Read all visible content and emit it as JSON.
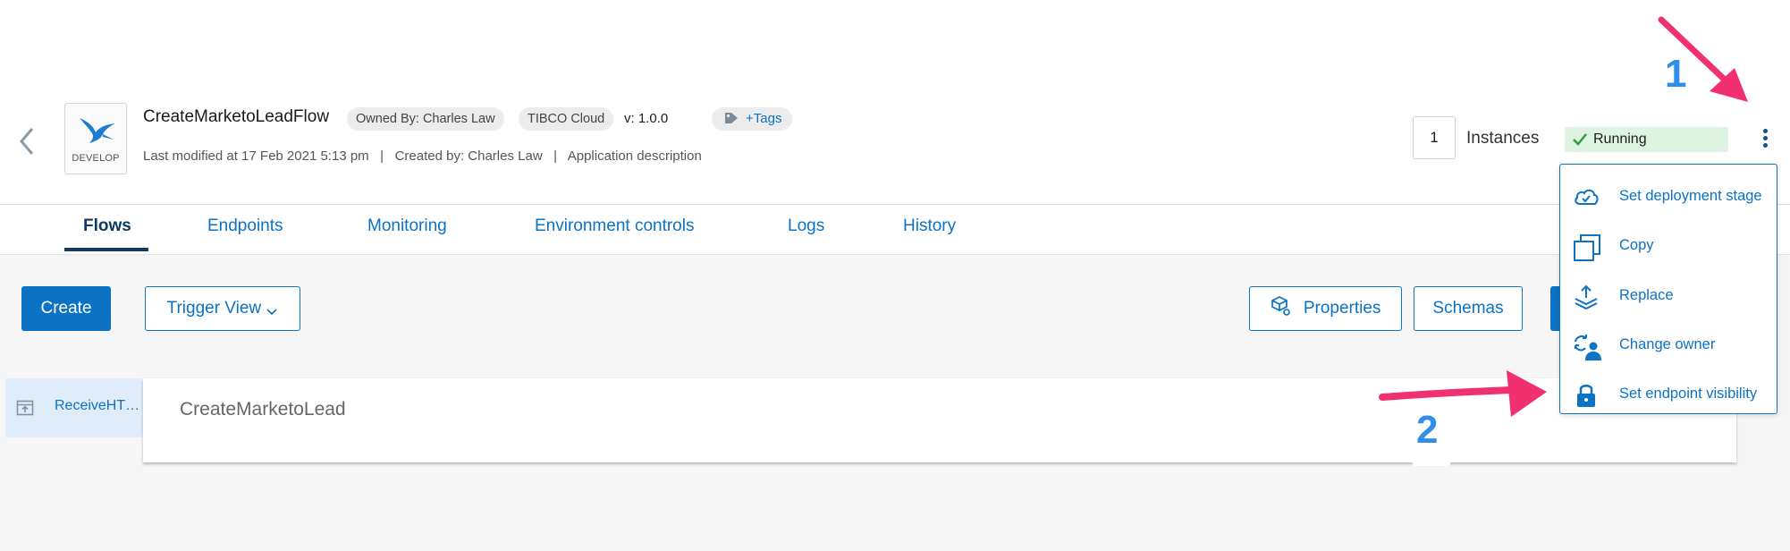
{
  "header": {
    "logo_label": "DEVELOP",
    "app_title": "CreateMarketoLeadFlow",
    "owner_label": "Owned By: Charles Law",
    "platform_label": "TIBCO Cloud",
    "version": "v: 1.0.0",
    "tags_label": "+Tags",
    "meta_line": "Last modified at 17 Feb 2021 5:13 pm   |   Created by: Charles Law   |   Application description",
    "instances_count": "1",
    "instances_label": "Instances",
    "status": "Running"
  },
  "tabs": [
    {
      "label": "Flows",
      "active": true
    },
    {
      "label": "Endpoints",
      "active": false
    },
    {
      "label": "Monitoring",
      "active": false
    },
    {
      "label": "Environment controls",
      "active": false
    },
    {
      "label": "Logs",
      "active": false
    },
    {
      "label": "History",
      "active": false
    }
  ],
  "toolbar": {
    "create_label": "Create",
    "trigger_view_label": "Trigger View",
    "properties_label": "Properties",
    "schemas_label": "Schemas"
  },
  "flow": {
    "trigger_label": "ReceiveHT…",
    "flow_name": "CreateMarketoLead"
  },
  "menu": {
    "items": [
      {
        "label": "Set deployment stage",
        "icon": "cloud-check-icon"
      },
      {
        "label": "Copy",
        "icon": "copy-icon"
      },
      {
        "label": "Replace",
        "icon": "replace-upload-icon"
      },
      {
        "label": "Change owner",
        "icon": "change-owner-icon"
      },
      {
        "label": "Set endpoint visibility",
        "icon": "lock-icon"
      }
    ]
  },
  "annotations": {
    "step_1": "1",
    "step_2": "2",
    "arrow_color": "#f0306f"
  },
  "colors": {
    "accent": "#0b72c4",
    "active_tab": "#0d3b66",
    "status_bg": "#dff3e2",
    "status_check": "#2e9e44"
  }
}
